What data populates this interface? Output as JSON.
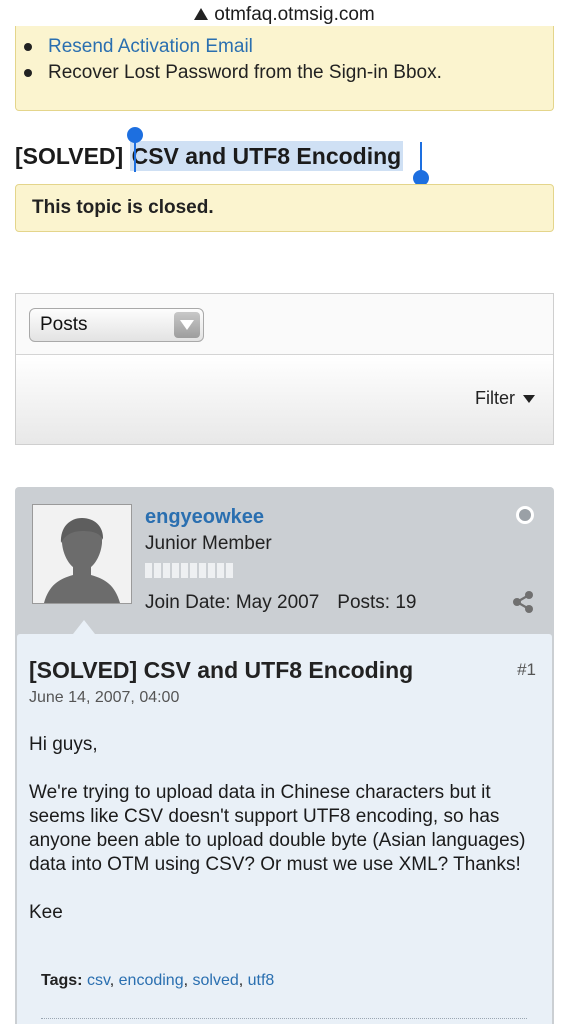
{
  "browser": {
    "url": "otmfaq.otmsig.com"
  },
  "notice": {
    "items": [
      "Resend Activation Email",
      "Recover Lost Password from the Sign-in Bbox."
    ]
  },
  "topic": {
    "prefix": "[SOLVED] ",
    "selected_text": "CSV and UTF8 Encoding",
    "closed_message": "This topic is closed."
  },
  "filter": {
    "select_value": "Posts",
    "filter_label": "Filter"
  },
  "post": {
    "username": "engyeowkee",
    "user_title": "Junior Member",
    "join_date": "Join Date: May 2007",
    "posts_count": "Posts: 19",
    "title": "[SOLVED] CSV and UTF8 Encoding",
    "number": "#1",
    "date": "June 14, 2007, 04:00",
    "paragraphs": [
      "Hi guys,",
      "We're trying to upload data in Chinese characters but it seems like CSV doesn't support UTF8 encoding, so has anyone been able to upload double byte (Asian languages) data into OTM using CSV? Or must we use XML? Thanks!",
      "Kee"
    ],
    "tags_label": "Tags:",
    "tags": [
      "csv",
      "encoding",
      "solved",
      "utf8"
    ]
  },
  "colors": {
    "link": "#2a6fb0",
    "notice_bg": "#fbf4cf",
    "selection": "#cfe0f4",
    "selection_handle": "#1d6fe0"
  },
  "icons": {
    "url_warning": "warning-triangle-icon",
    "share": "share-icon",
    "online_status": "status-dot-icon",
    "dropdown": "chevron-down-icon"
  }
}
